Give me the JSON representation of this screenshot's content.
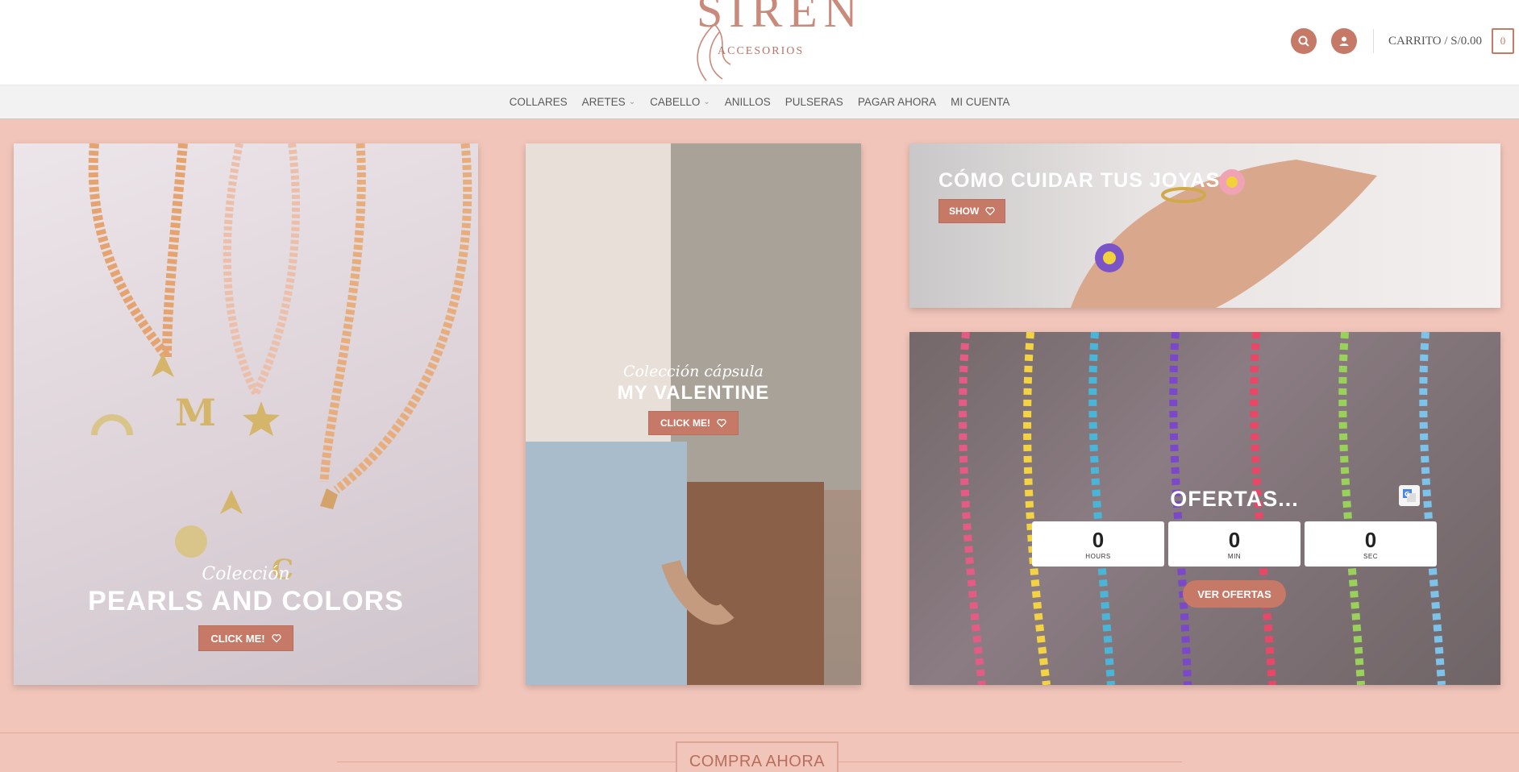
{
  "header": {
    "logo_word": "SIREN",
    "logo_sub": "ACCESORIOS",
    "cart_label": "CARRITO / S/0.00",
    "cart_count": "0"
  },
  "nav": {
    "items": [
      {
        "label": "COLLARES",
        "dropdown": false
      },
      {
        "label": "ARETES",
        "dropdown": true
      },
      {
        "label": "CABELLO",
        "dropdown": true
      },
      {
        "label": "ANILLOS",
        "dropdown": false
      },
      {
        "label": "PULSERAS",
        "dropdown": false
      },
      {
        "label": "PAGAR AHORA",
        "dropdown": false
      },
      {
        "label": "MI CUENTA",
        "dropdown": false
      }
    ]
  },
  "panels": {
    "pearls": {
      "script": "Colección",
      "title": "PEARLS AND COLORS",
      "button": "CLICK ME!"
    },
    "valentine": {
      "script": "Colección cápsula",
      "title": "MY VALENTINE",
      "button": "CLICK ME!"
    },
    "care": {
      "title": "CÓMO CUIDAR TUS JOYAS",
      "button": "SHOW"
    },
    "offers": {
      "title": "OFERTAS...",
      "timer": [
        {
          "value": "0",
          "label": "HOURS"
        },
        {
          "value": "0",
          "label": "MIN"
        },
        {
          "value": "0",
          "label": "SEC"
        }
      ],
      "button": "VER OFERTAS"
    }
  },
  "bottom": {
    "shop_now": "COMPRA AHORA"
  },
  "colors": {
    "accent": "#c67966",
    "page_bg": "#f1c5ba"
  }
}
